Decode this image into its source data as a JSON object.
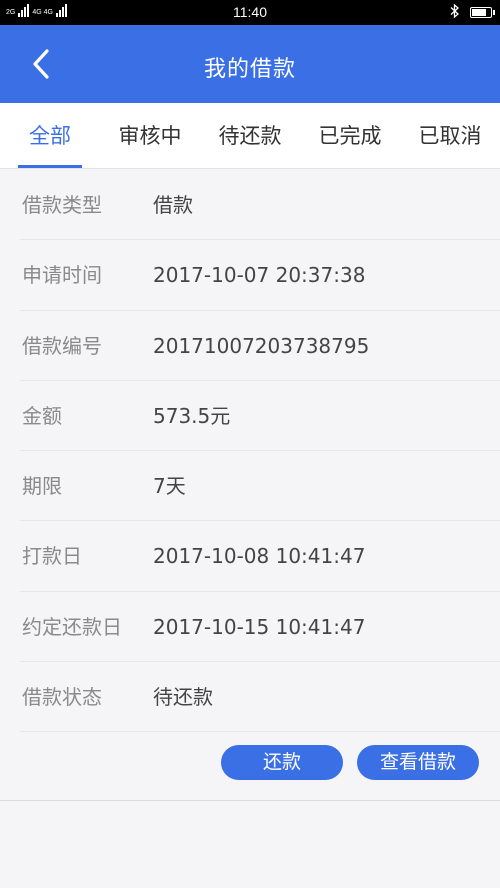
{
  "status_bar": {
    "signal_left": "2G",
    "signal_right": "4G 4G",
    "time": "11:40",
    "bluetooth_icon": "bluetooth-icon",
    "battery_level": 0.85
  },
  "header": {
    "back_icon": "chevron-left-icon",
    "title": "我的借款"
  },
  "tabs": [
    {
      "label": "全部",
      "active": true
    },
    {
      "label": "审核中",
      "active": false
    },
    {
      "label": "待还款",
      "active": false
    },
    {
      "label": "已完成",
      "active": false
    },
    {
      "label": "已取消",
      "active": false
    }
  ],
  "details": [
    {
      "label": "借款类型",
      "value": "借款"
    },
    {
      "label": "申请时间",
      "value": "2017-10-07 20:37:38"
    },
    {
      "label": "借款编号",
      "value": "20171007203738795"
    },
    {
      "label": "金额",
      "value": "573.5元"
    },
    {
      "label": "期限",
      "value": "7天"
    },
    {
      "label": "打款日",
      "value": "2017-10-08 10:41:47"
    },
    {
      "label": "约定还款日",
      "value": "2017-10-15 10:41:47"
    },
    {
      "label": "借款状态",
      "value": "待还款"
    }
  ],
  "actions": {
    "repay_label": "还款",
    "view_label": "查看借款"
  },
  "colors": {
    "primary": "#3a6fe5",
    "label_text": "#8a8a8a",
    "value_text": "#444444"
  }
}
